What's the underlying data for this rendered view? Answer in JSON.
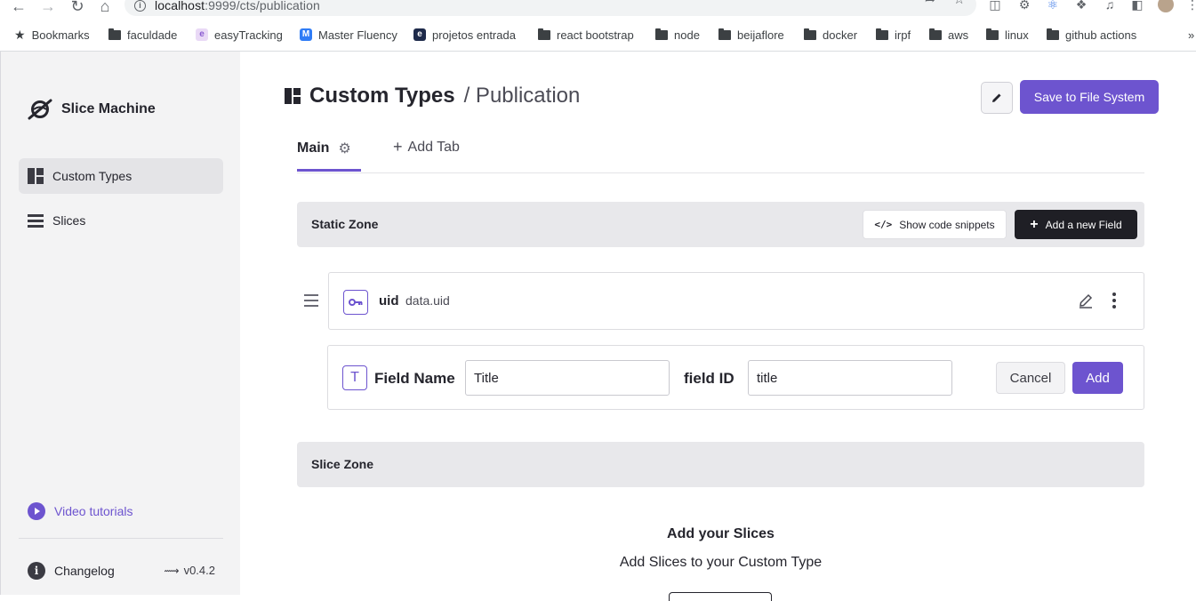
{
  "browser": {
    "url_host": "localhost",
    "url_rest": ":9999/cts/publication",
    "bookmarks": [
      {
        "label": "Bookmarks",
        "icon": "star-icon"
      },
      {
        "label": "faculdade",
        "icon": "folder-icon"
      },
      {
        "label": "easyTracking",
        "icon": "favicon"
      },
      {
        "label": "Master Fluency",
        "icon": "favicon"
      },
      {
        "label": "projetos entrada",
        "icon": "favicon"
      },
      {
        "label": "react bootstrap",
        "icon": "folder-icon"
      },
      {
        "label": "node",
        "icon": "folder-icon"
      },
      {
        "label": "beijaflore",
        "icon": "folder-icon"
      },
      {
        "label": "docker",
        "icon": "folder-icon"
      },
      {
        "label": "irpf",
        "icon": "folder-icon"
      },
      {
        "label": "aws",
        "icon": "folder-icon"
      },
      {
        "label": "linux",
        "icon": "folder-icon"
      },
      {
        "label": "github actions",
        "icon": "folder-icon"
      }
    ],
    "overflow": "»"
  },
  "sidebar": {
    "brand": "Slice Machine",
    "items": [
      {
        "label": "Custom Types",
        "active": true
      },
      {
        "label": "Slices",
        "active": false
      }
    ],
    "video_tutorials": "Video tutorials",
    "changelog": "Changelog",
    "version": "v0.4.2"
  },
  "header": {
    "title": "Custom Types",
    "subtitle": "/ Publication",
    "save_label": "Save to File System"
  },
  "tabs": {
    "main": "Main",
    "add_tab": "Add Tab"
  },
  "static_zone": {
    "title": "Static Zone",
    "snippets_label": "Show code snippets",
    "add_field_label": "Add a new Field",
    "field": {
      "name": "uid",
      "path": "data.uid"
    }
  },
  "new_field": {
    "icon_letter": "T",
    "name_label": "Field Name",
    "name_value": "Title",
    "id_label": "field ID",
    "id_value": "title",
    "cancel_label": "Cancel",
    "add_label": "Add"
  },
  "slice_zone": {
    "title": "Slice Zone",
    "empty_title": "Add your Slices",
    "empty_subtitle": "Add Slices to your Custom Type"
  },
  "colors": {
    "accent": "#6d54cf",
    "dark_button": "#1f1f25",
    "sidebar_bg": "#f3f3f4",
    "zone_bg": "#e8e8eb"
  }
}
